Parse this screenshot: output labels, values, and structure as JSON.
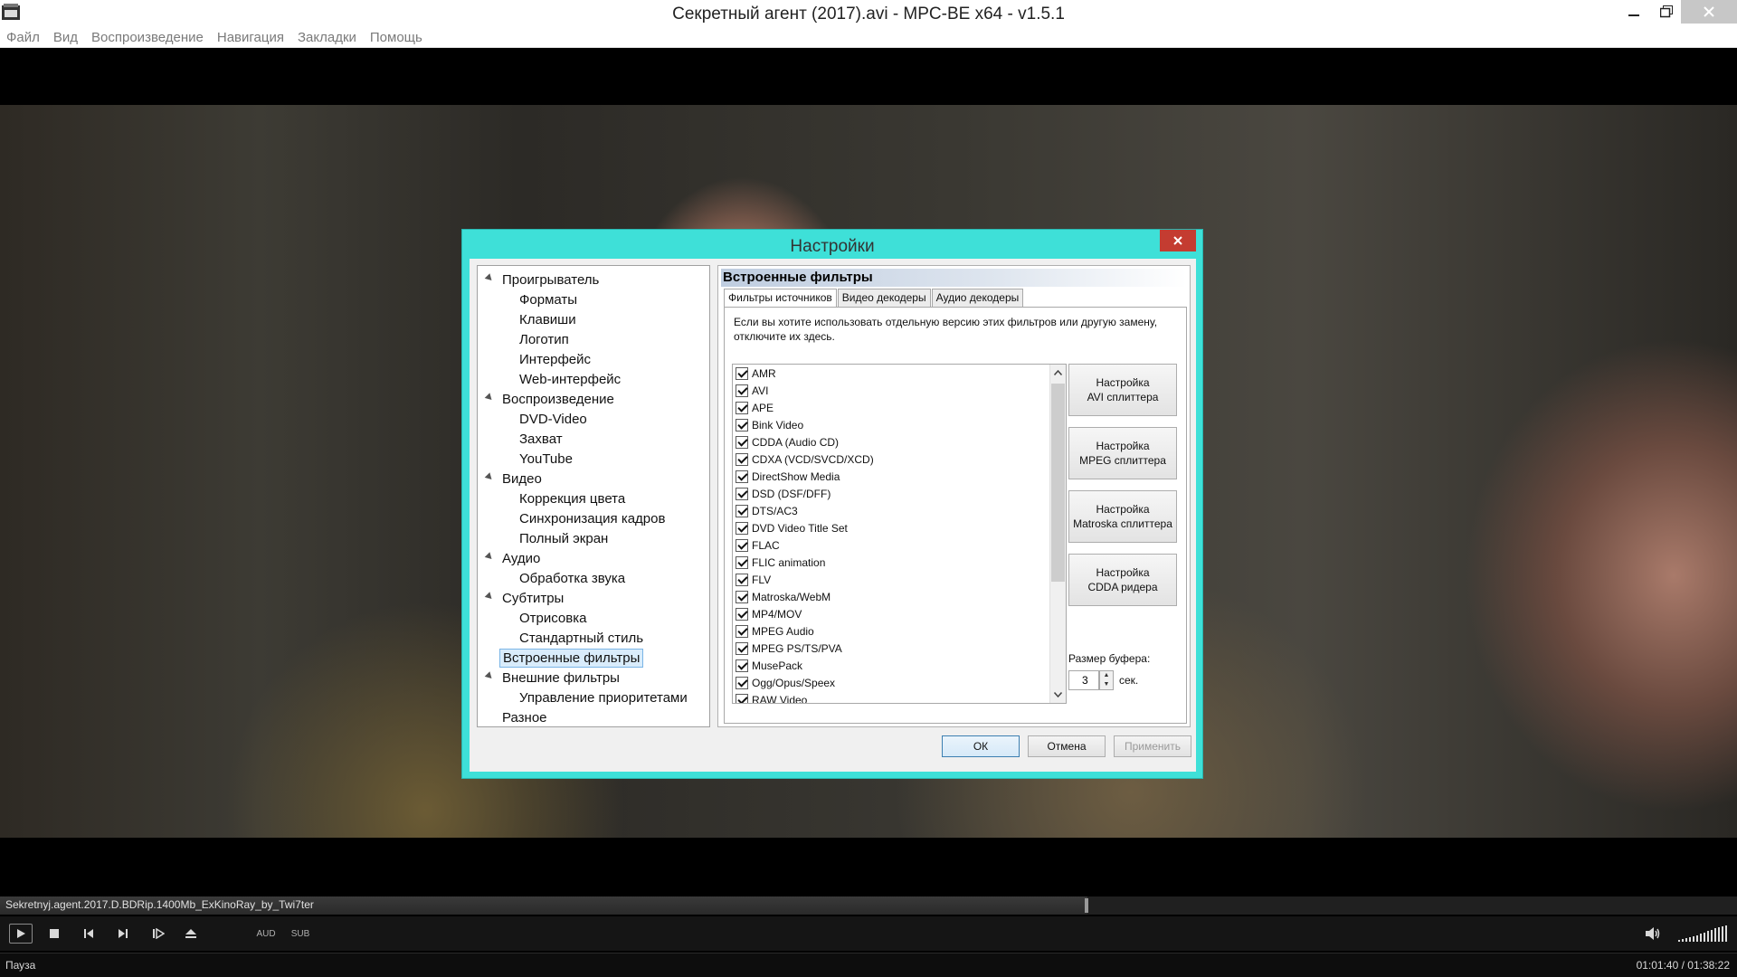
{
  "window": {
    "title": "Секретный агент (2017).avi - MPC-BE x64 - v1.5.1"
  },
  "menu": [
    "Файл",
    "Вид",
    "Воспроизведение",
    "Навигация",
    "Закладки",
    "Помощь"
  ],
  "player": {
    "filename": "Sekretnyj.agent.2017.D.BDRip.1400Mb_ExKinoRay_by_Twi7ter",
    "seek_progress": 0.626,
    "aud_label": "AUD",
    "sub_label": "SUB",
    "status": "Пауза",
    "time": "01:01:40 / 01:38:22"
  },
  "dialog": {
    "title": "Настройки",
    "tree": [
      {
        "label": "Проигрыватель",
        "level": 0
      },
      {
        "label": "Форматы",
        "level": 1
      },
      {
        "label": "Клавиши",
        "level": 1
      },
      {
        "label": "Логотип",
        "level": 1
      },
      {
        "label": "Интерфейс",
        "level": 1
      },
      {
        "label": "Web-интерфейс",
        "level": 1
      },
      {
        "label": "Воспроизведение",
        "level": 0
      },
      {
        "label": "DVD-Video",
        "level": 1
      },
      {
        "label": "Захват",
        "level": 1
      },
      {
        "label": "YouTube",
        "level": 1
      },
      {
        "label": "Видео",
        "level": 0
      },
      {
        "label": "Коррекция цвета",
        "level": 1
      },
      {
        "label": "Синхронизация кадров",
        "level": 1
      },
      {
        "label": "Полный экран",
        "level": 1
      },
      {
        "label": "Аудио",
        "level": 0
      },
      {
        "label": "Обработка звука",
        "level": 1
      },
      {
        "label": "Субтитры",
        "level": 0
      },
      {
        "label": "Отрисовка",
        "level": 1
      },
      {
        "label": "Стандартный стиль",
        "level": 1
      },
      {
        "label": "Встроенные фильтры",
        "level": 0,
        "selected": true,
        "noarrow": true
      },
      {
        "label": "Внешние фильтры",
        "level": 0
      },
      {
        "label": "Управление приоритетами",
        "level": 1
      },
      {
        "label": "Разное",
        "level": 0,
        "noarrow": true
      }
    ],
    "panel_header": "Встроенные фильтры",
    "tabs": [
      "Фильтры источников",
      "Видео декодеры",
      "Аудио декодеры"
    ],
    "description": "Если вы хотите использовать отдельную версию этих фильтров или другую замену, отключите их здесь.",
    "filters": [
      "AMR",
      "AVI",
      "APE",
      "Bink Video",
      "CDDA (Audio CD)",
      "CDXA (VCD/SVCD/XCD)",
      "DirectShow Media",
      "DSD (DSF/DFF)",
      "DTS/AC3",
      "DVD Video Title Set",
      "FLAC",
      "FLIC animation",
      "FLV",
      "Matroska/WebM",
      "MP4/MOV",
      "MPEG Audio",
      "MPEG PS/TS/PVA",
      "MusePack",
      "Ogg/Opus/Speex",
      "RAW Video"
    ],
    "side_buttons": [
      {
        "line1": "Настройка",
        "line2": "AVI сплиттера"
      },
      {
        "line1": "Настройка",
        "line2": "MPEG сплиттера"
      },
      {
        "line1": "Настройка",
        "line2": "Matroska сплиттера"
      },
      {
        "line1": "Настройка",
        "line2": "CDDA ридера"
      }
    ],
    "buffer_label": "Размер буфера:",
    "buffer_value": "3",
    "buffer_unit": "сек.",
    "buttons": {
      "ok": "ОК",
      "cancel": "Отмена",
      "apply": "Применить"
    }
  },
  "colors": {
    "dialog_frame": "#3ee0d8",
    "close_red": "#c43c31",
    "selection": "#d9ecfb"
  }
}
